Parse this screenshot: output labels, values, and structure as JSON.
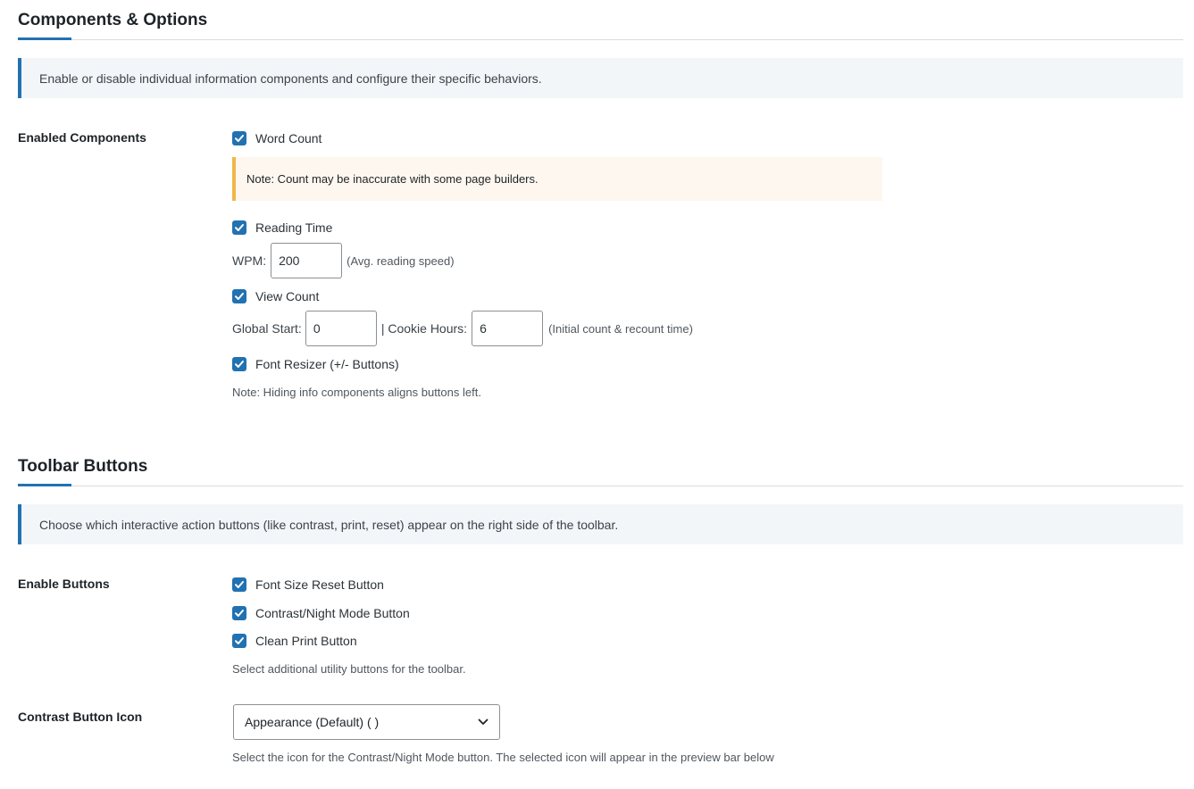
{
  "components": {
    "title": "Components & Options",
    "description": "Enable or disable individual information components and configure their specific behaviors.",
    "enabled_label": "Enabled Components",
    "word_count": {
      "label": "Word Count",
      "checked": true
    },
    "note": "Note: Count may be inaccurate with some page builders.",
    "reading_time": {
      "label": "Reading Time",
      "checked": true
    },
    "wpm_label": "WPM:",
    "wpm_value": "200",
    "wpm_hint": "(Avg. reading speed)",
    "view_count": {
      "label": "View Count",
      "checked": true
    },
    "global_start_label": "Global Start:",
    "global_start_value": "0",
    "cookie_hours_label": "| Cookie Hours:",
    "cookie_hours_value": "6",
    "view_hint": "(Initial count & recount time)",
    "font_resizer": {
      "label": "Font Resizer (+/- Buttons)",
      "checked": true
    },
    "hiding_note": "Note: Hiding info components aligns buttons left."
  },
  "toolbar": {
    "title": "Toolbar Buttons",
    "description": "Choose which interactive action buttons (like contrast, print, reset) appear on the right side of the toolbar.",
    "enable_label": "Enable Buttons",
    "font_reset": {
      "label": "Font Size Reset Button",
      "checked": true
    },
    "contrast": {
      "label": "Contrast/Night Mode Button",
      "checked": true
    },
    "print": {
      "label": "Clean Print Button",
      "checked": true
    },
    "buttons_note": "Select additional utility buttons for the toolbar.",
    "icon_label": "Contrast Button Icon",
    "icon_selected": "Appearance (Default) ( )",
    "icon_note": "Select the icon for the Contrast/Night Mode button. The selected icon will appear in the preview bar below"
  },
  "colors": {
    "accent": "#2271b1",
    "warning": "#f0b849"
  },
  "icons": {
    "checkbox": "checkmark-icon",
    "select_arrow": "chevron-down-icon"
  }
}
